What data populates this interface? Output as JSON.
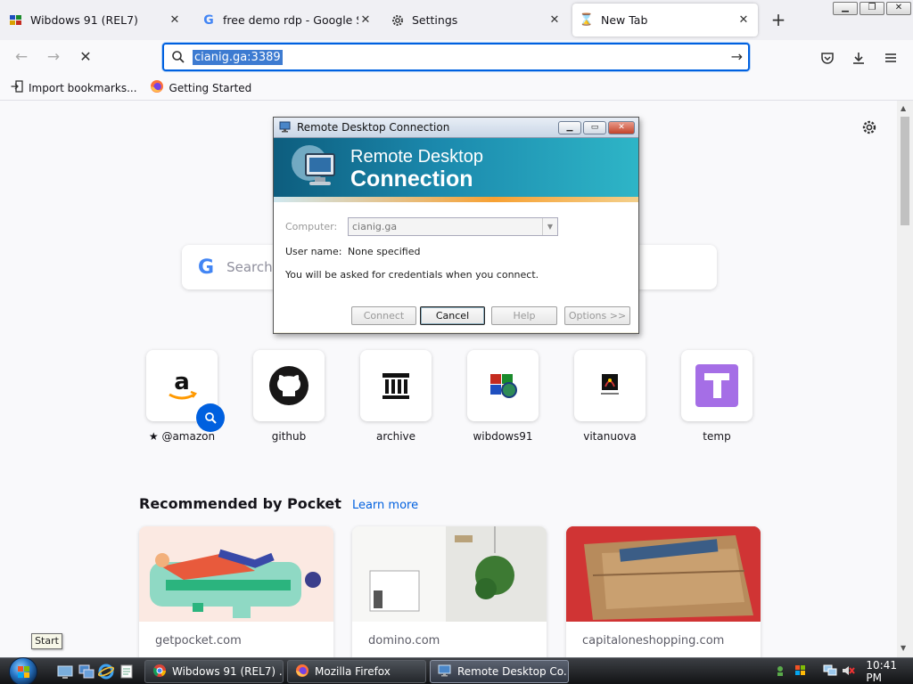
{
  "tabs": [
    {
      "title": "Wibdows 91 (REL7)",
      "icon": "wibdows-icon",
      "active": false
    },
    {
      "title": "free demo rdp - Google Search",
      "icon": "google-icon",
      "active": false
    },
    {
      "title": "Settings",
      "icon": "gear-icon",
      "active": false
    },
    {
      "title": "New Tab",
      "icon": "hourglass-icon",
      "active": true
    }
  ],
  "url": {
    "value": "cianig.ga:3389"
  },
  "bookmarks": [
    {
      "label": "Import bookmarks...",
      "icon": "import-icon"
    },
    {
      "label": "Getting Started",
      "icon": "firefox-icon"
    }
  ],
  "search": {
    "placeholder": "Search"
  },
  "top_sites": [
    {
      "label": "@amazon",
      "icon": "amazon-icon"
    },
    {
      "label": "github",
      "icon": "github-icon"
    },
    {
      "label": "archive",
      "icon": "archive-icon"
    },
    {
      "label": "wibdows91",
      "icon": "windows-flag-icon"
    },
    {
      "label": "vitanuova",
      "icon": "vitanuova-icon"
    },
    {
      "label": "temp",
      "icon": "temp-icon"
    }
  ],
  "pocket": {
    "heading": "Recommended by Pocket",
    "learn_more": "Learn more",
    "cards": [
      {
        "source": "getpocket.com"
      },
      {
        "source": "domino.com"
      },
      {
        "source": "capitaloneshopping.com"
      }
    ]
  },
  "rdp": {
    "title": "Remote Desktop Connection",
    "banner_line1": "Remote Desktop",
    "banner_line2": "Connection",
    "computer_label": "Computer:",
    "computer_value": "cianig.ga",
    "username_label": "User name:",
    "username_value": "None specified",
    "info": "You will be asked for credentials when you connect.",
    "buttons": {
      "connect": "Connect",
      "cancel": "Cancel",
      "help": "Help",
      "options": "Options >>"
    }
  },
  "taskbar": {
    "start_tooltip": "Start",
    "buttons": [
      {
        "label": "Wibdows 91 (REL7) ..."
      },
      {
        "label": "Mozilla Firefox"
      },
      {
        "label": "Remote Desktop Co..."
      }
    ],
    "clock": "10:41 PM"
  },
  "colors": {
    "accent": "#0060df",
    "url_highlight": "#3d7bd1",
    "rdp_banner": "#1b89ad"
  }
}
